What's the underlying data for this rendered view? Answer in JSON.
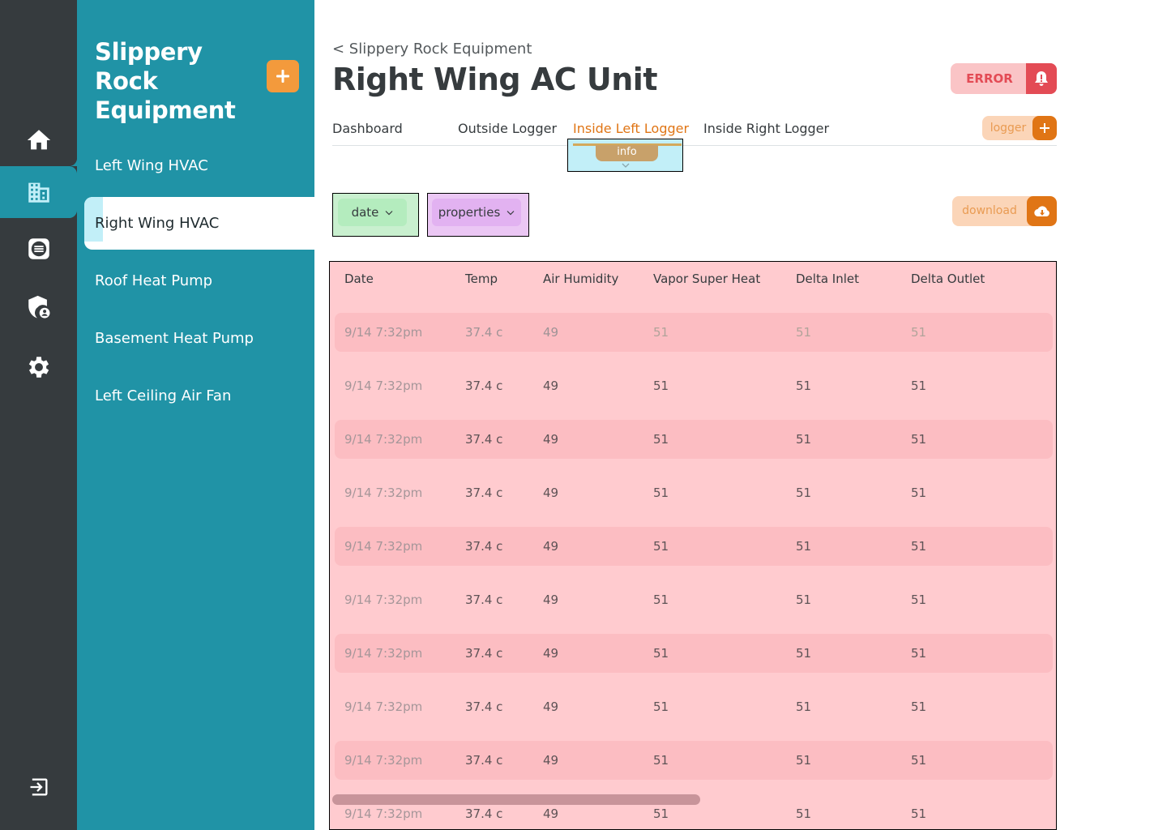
{
  "app": {
    "panel_title": "Slippery Rock Equipment"
  },
  "rail": {
    "items": [
      {
        "icon": "home-icon"
      },
      {
        "icon": "building-icon"
      },
      {
        "icon": "list-icon"
      },
      {
        "icon": "shield-user-icon"
      },
      {
        "icon": "gear-icon"
      },
      {
        "icon": "logout-icon"
      }
    ]
  },
  "sidebar": {
    "items": [
      {
        "label": "Left Wing HVAC"
      },
      {
        "label": "Right Wing HVAC"
      },
      {
        "label": "Roof Heat Pump"
      },
      {
        "label": "Basement Heat Pump"
      },
      {
        "label": "Left Ceiling Air Fan"
      }
    ],
    "active_index": 1
  },
  "header": {
    "breadcrumb": "< Slippery Rock Equipment",
    "title": "Right Wing AC Unit",
    "status": "ERROR"
  },
  "tabs": [
    {
      "label": "Dashboard"
    },
    {
      "label": "Outside Logger"
    },
    {
      "label": "Inside Left Logger"
    },
    {
      "label": "Inside Right Logger"
    }
  ],
  "active_tab_index": 2,
  "info_label": "info",
  "logger_button": "logger",
  "filters": {
    "date": "date",
    "properties": "properties"
  },
  "download_button": "download",
  "colors": {
    "rail": "#363b3e",
    "panel": "#2093a6",
    "accent_orange": "#e07515",
    "error_red": "#e34b55",
    "active_tab": "#e07515"
  },
  "table": {
    "columns": [
      "Date",
      "Temp",
      "Air Humidity",
      "Vapor Super Heat",
      "Delta Inlet",
      "Delta Outlet"
    ],
    "rows": [
      [
        "9/14  7:32pm",
        "37.4 c",
        "49",
        "51",
        "51",
        "51"
      ],
      [
        "9/14  7:32pm",
        "37.4 c",
        "49",
        "51",
        "51",
        "51"
      ],
      [
        "9/14  7:32pm",
        "37.4 c",
        "49",
        "51",
        "51",
        "51"
      ],
      [
        "9/14  7:32pm",
        "37.4 c",
        "49",
        "51",
        "51",
        "51"
      ],
      [
        "9/14  7:32pm",
        "37.4 c",
        "49",
        "51",
        "51",
        "51"
      ],
      [
        "9/14  7:32pm",
        "37.4 c",
        "49",
        "51",
        "51",
        "51"
      ],
      [
        "9/14  7:32pm",
        "37.4 c",
        "49",
        "51",
        "51",
        "51"
      ],
      [
        "9/14  7:32pm",
        "37.4 c",
        "49",
        "51",
        "51",
        "51"
      ],
      [
        "9/14  7:32pm",
        "37.4 c",
        "49",
        "51",
        "51",
        "51"
      ],
      [
        "9/14  7:32pm",
        "37.4 c",
        "49",
        "51",
        "51",
        "51"
      ]
    ]
  }
}
